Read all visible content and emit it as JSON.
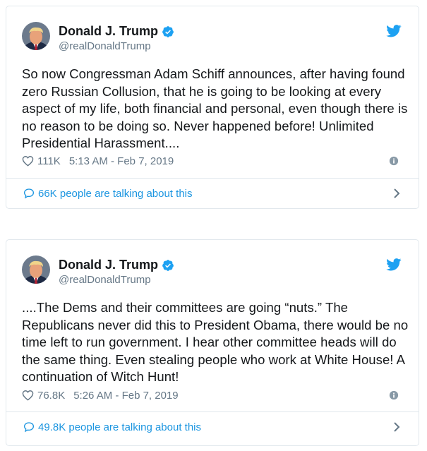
{
  "tweets": [
    {
      "display_name": "Donald J. Trump",
      "handle": "@realDonaldTrump",
      "text_lines": [
        "So now Congressman Adam Schiff announces, after having found",
        "zero Russian Collusion, that he is going to be looking at every",
        "aspect of my life, both financial and personal, even though there is",
        "no reason to be doing so. Never happened before! Unlimited",
        "Presidential Harassment...."
      ],
      "likes": "111K",
      "timestamp": "5:13 AM - Feb 7, 2019",
      "talking": "66K people are talking about this"
    },
    {
      "display_name": "Donald J. Trump",
      "handle": "@realDonaldTrump",
      "text_lines": [
        "....The Dems and their committees are going “nuts.” The",
        "Republicans never did this to President Obama, there would be no",
        "time left to run government. I hear other committee heads will do",
        "the same thing. Even stealing people who work at White House! A",
        "continuation of Witch Hunt!"
      ],
      "likes": "76.8K",
      "timestamp": "5:26 AM - Feb 7, 2019",
      "talking": "49.8K people are talking about this"
    }
  ],
  "colors": {
    "link_blue": "#1b95e0",
    "twitter_blue": "#1da1f2",
    "muted_gray": "#657786",
    "border": "#e1e8ed"
  },
  "icons": [
    "avatar",
    "verified-badge-icon",
    "twitter-bird-icon",
    "heart-icon",
    "info-icon",
    "speech-bubble-icon",
    "chevron-right-icon"
  ]
}
